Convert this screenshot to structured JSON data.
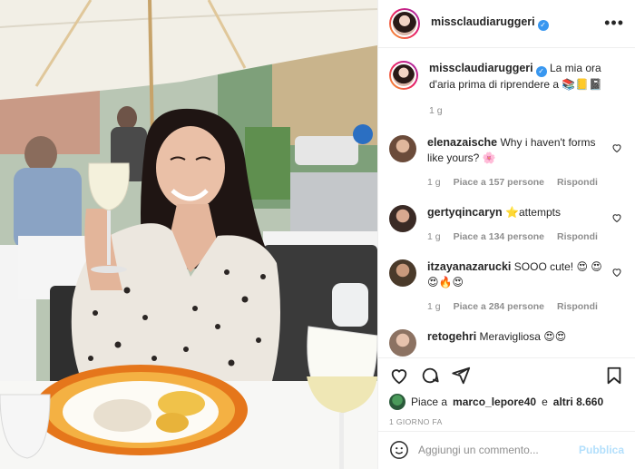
{
  "post": {
    "username": "missclaudiaruggeri",
    "verified": true,
    "more_icon": "more-horizontal-icon",
    "caption_text": "La mia ora d'aria prima di riprendere a 📚📒📓",
    "caption_time": "1 g"
  },
  "comments": [
    {
      "user": "elenazaische",
      "text": "Why i haven't forms like yours? 🌸",
      "time": "1 g",
      "likes": "Piace a 157 persone",
      "reply": "Rispondi"
    },
    {
      "user": "gertyqincaryn",
      "text": "⭐attempts",
      "time": "1 g",
      "likes": "Piace a 134 persone",
      "reply": "Rispondi"
    },
    {
      "user": "itzayanazarucki",
      "text": "SOOO cute! 😍 😍😍🔥😍",
      "time": "1 g",
      "likes": "Piace a 284 persone",
      "reply": "Rispondi"
    },
    {
      "user": "retogehri",
      "text": "Meravigliosa 😍😍",
      "time": "",
      "likes": "",
      "reply": ""
    }
  ],
  "actions": {
    "like_icon": "heart-icon",
    "comment_icon": "comment-icon",
    "share_icon": "share-icon",
    "save_icon": "bookmark-icon"
  },
  "likes": {
    "prefix": "Piace a",
    "user": "marco_lepore40",
    "mid": "e",
    "others": "altri 8.660"
  },
  "date": "1 GIORNO FA",
  "add_comment": {
    "emoji_icon": "emoji-icon",
    "placeholder": "Aggiungi un commento...",
    "publish": "Pubblica"
  },
  "colors": {
    "accent": "#3897f0",
    "publish_disabled": "#b2dffc",
    "muted": "#8e8e8e"
  }
}
